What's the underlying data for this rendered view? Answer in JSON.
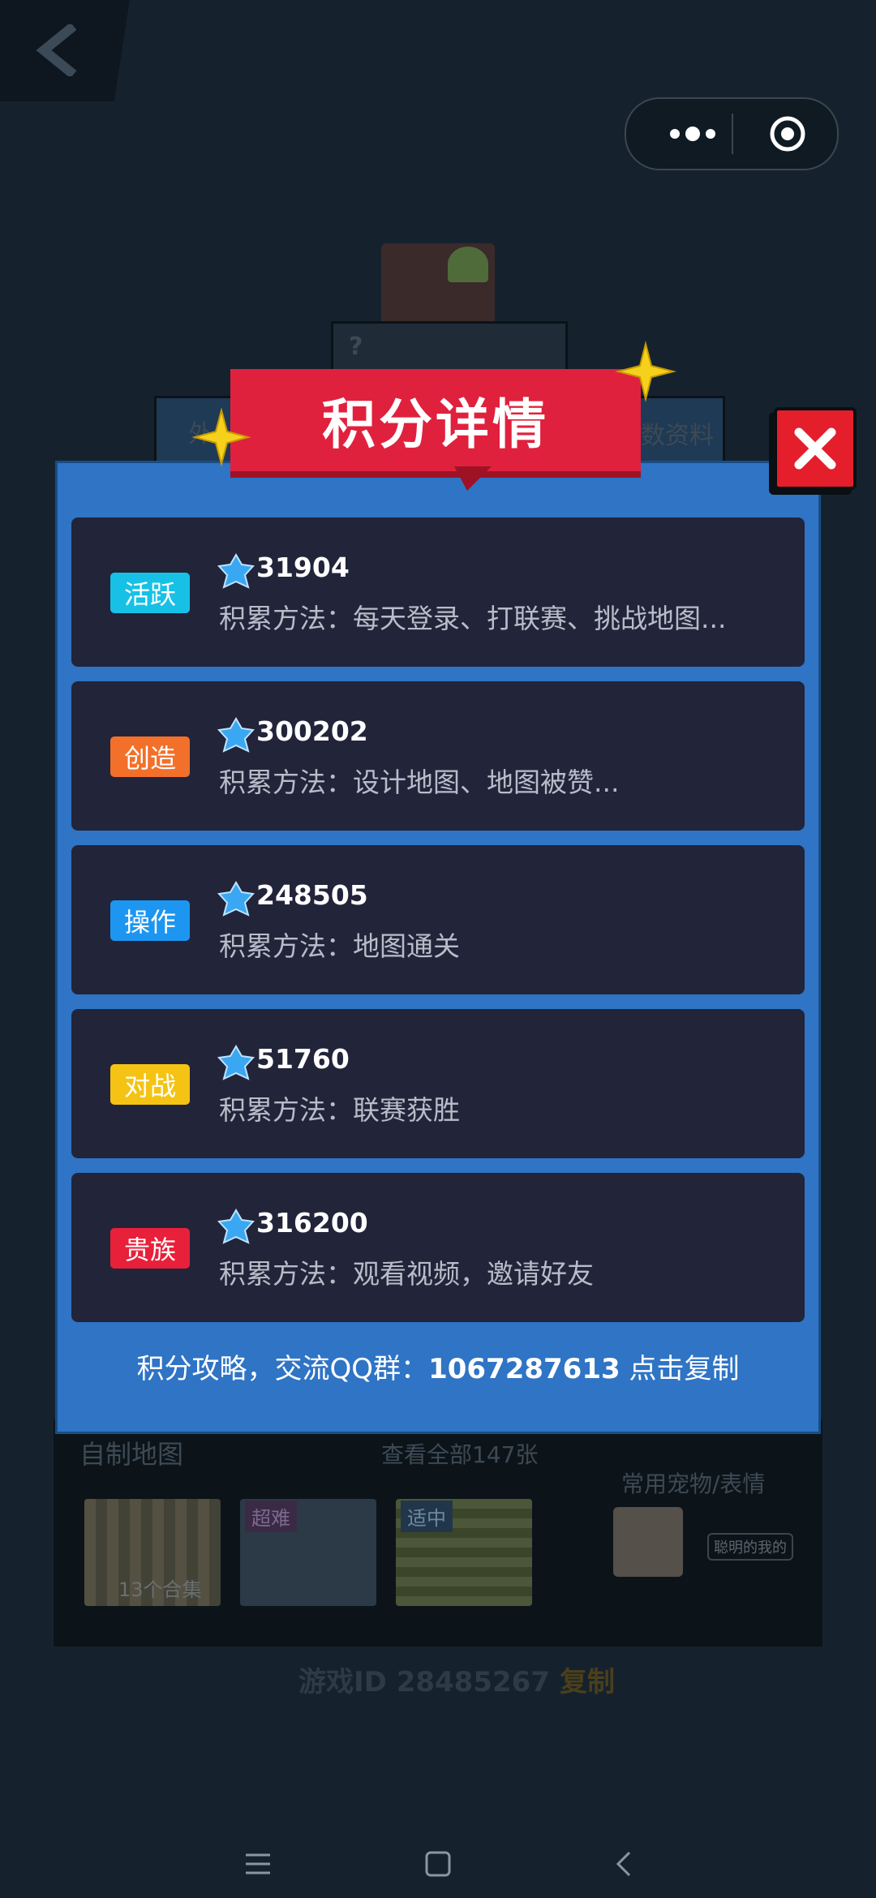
{
  "background": {
    "map_section_label": "自制地图",
    "view_all": "查看全部147张",
    "pets_label": "常用宠物/表情",
    "pet_badge": "聪明的我的",
    "collection_label": "13个合集",
    "thumb_tags": [
      "超难",
      "适中"
    ],
    "game_id": "游戏ID 28485267",
    "copy_label": "复制",
    "tab_left_fragment": "外",
    "tab_right_fragment": "数资料",
    "question_mark": "?"
  },
  "modal": {
    "title": "积分详情",
    "cards": [
      {
        "tag": "活跃",
        "tag_color": "#17c1e6",
        "score": "31904",
        "method": "积累方法：每天登录、打联赛、挑战地图..."
      },
      {
        "tag": "创造",
        "tag_color": "#f2702a",
        "score": "300202",
        "method": "积累方法：设计地图、地图被赞..."
      },
      {
        "tag": "操作",
        "tag_color": "#1c96f0",
        "score": "248505",
        "method": "积累方法：地图通关"
      },
      {
        "tag": "对战",
        "tag_color": "#f4c313",
        "score": "51760",
        "method": "积累方法：联赛获胜"
      },
      {
        "tag": "贵族",
        "tag_color": "#e8203a",
        "score": "316200",
        "method": "积累方法：观看视频，邀请好友"
      }
    ],
    "footer_prefix": "积分攻略，交流QQ群：",
    "footer_group": "1067287613",
    "footer_action": "点击复制"
  },
  "colors": {
    "modal_bg": "#2f74c5",
    "banner": "#e0213e",
    "card_bg": "#22243a",
    "close": "#e41e2b"
  },
  "icons": [
    "back-chevron-icon",
    "more-dots-icon",
    "target-icon",
    "close-icon",
    "gem-icon",
    "star-icon",
    "menu-icon",
    "home-icon",
    "back-icon"
  ]
}
